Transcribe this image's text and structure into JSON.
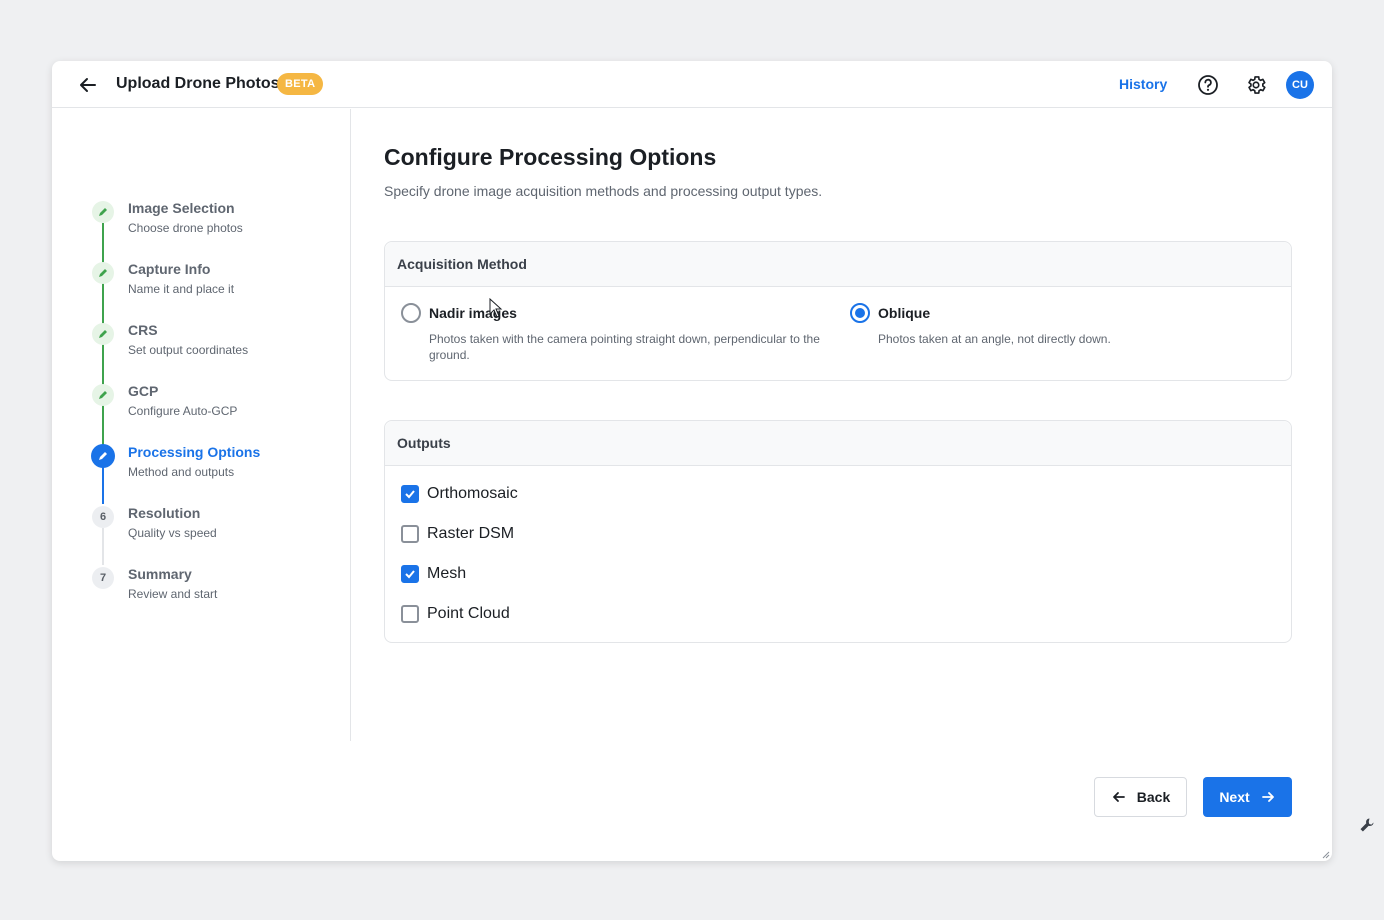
{
  "header": {
    "title": "Upload Drone Photos",
    "badge": "BETA",
    "history_label": "History",
    "avatar_initials": "CU"
  },
  "sidebar": {
    "steps": [
      {
        "title": "Image Selection",
        "subtitle": "Choose drone photos",
        "status": "done"
      },
      {
        "title": "Capture Info",
        "subtitle": "Name it and place it",
        "status": "done"
      },
      {
        "title": "CRS",
        "subtitle": "Set output coordinates",
        "status": "done"
      },
      {
        "title": "GCP",
        "subtitle": "Configure Auto-GCP",
        "status": "done"
      },
      {
        "title": "Processing Options",
        "subtitle": "Method and outputs",
        "status": "active"
      },
      {
        "title": "Resolution",
        "subtitle": "Quality vs speed",
        "status": "todo",
        "number": "6"
      },
      {
        "title": "Summary",
        "subtitle": "Review and start",
        "status": "todo",
        "number": "7"
      }
    ]
  },
  "main": {
    "heading": "Configure Processing Options",
    "subheading": "Specify drone image acquisition methods and processing output types.",
    "acquisition": {
      "title": "Acquisition Method",
      "options": [
        {
          "label": "Nadir images",
          "description": "Photos taken with the camera pointing straight down, perpendicular to the ground.",
          "selected": false
        },
        {
          "label": "Oblique",
          "description": "Photos taken at an angle, not directly down.",
          "selected": true
        }
      ]
    },
    "outputs": {
      "title": "Outputs",
      "items": [
        {
          "label": "Orthomosaic",
          "checked": true
        },
        {
          "label": "Raster DSM",
          "checked": false
        },
        {
          "label": "Mesh",
          "checked": true
        },
        {
          "label": "Point Cloud",
          "checked": false
        }
      ]
    }
  },
  "footer": {
    "back_label": "Back",
    "next_label": "Next"
  },
  "colors": {
    "accent": "#1a73e8",
    "done_green": "#3fa34d",
    "beta": "#f5b743"
  },
  "icons": [
    "back-arrow-icon",
    "help-icon",
    "gear-icon",
    "pencil-icon",
    "wrench-icon"
  ]
}
